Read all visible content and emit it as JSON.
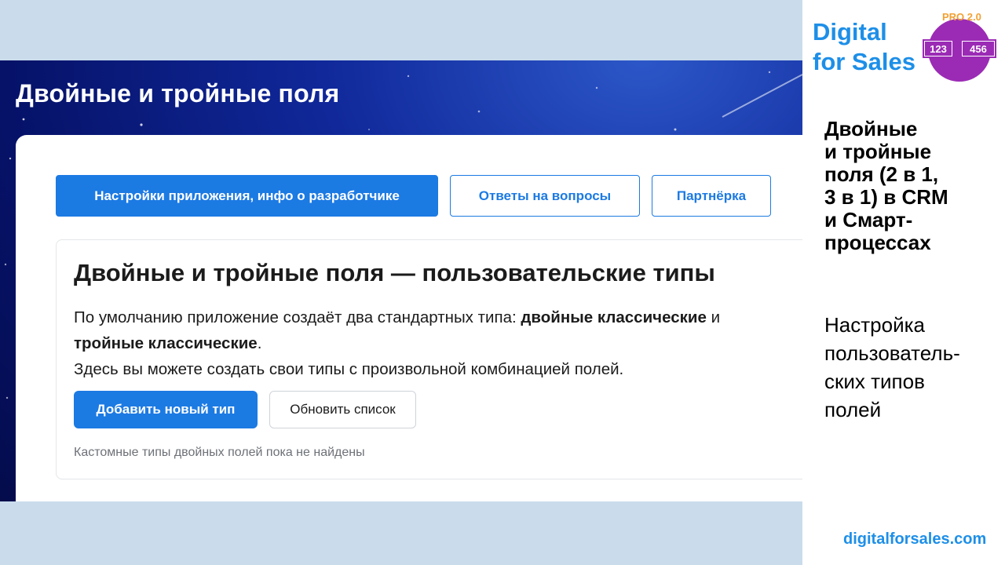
{
  "app": {
    "header_title": "Двойные и тройные поля",
    "tabs": [
      {
        "label": "Настройки приложения, инфо о разработчике",
        "active": true
      },
      {
        "label": "Ответы на вопросы",
        "active": false
      },
      {
        "label": "Партнёрка",
        "active": false
      }
    ],
    "section": {
      "title": "Двойные и тройные поля — пользовательские типы",
      "desc_part1": "По умолчанию приложение создаёт два стандартных типа: ",
      "desc_bold1": "двойные классические",
      "desc_part2": " и ",
      "desc_bold2": "тройные классические",
      "desc_part3": ".",
      "desc_line2": "Здесь вы можете создать свои типы с произвольной комбинацией полей.",
      "add_button": "Добавить новый тип",
      "refresh_button": "Обновить список",
      "empty_note": "Кастомные типы двойных полей пока не найдены"
    }
  },
  "side": {
    "brand_line1": "Digital",
    "brand_line2": "for Sales",
    "logo_badge": "PRO 2.0",
    "logo_num1": "123",
    "logo_num2": "456",
    "title": "Двойные\nи тройные\nполя (2 в 1,\n3 в 1) в CRM\nи Смарт-\nпроцессах",
    "subtitle": "Настройка\nпользователь-\nских типов\nполей",
    "website": "digitalforsales.com"
  },
  "colors": {
    "accent_blue": "#1c7ae3",
    "brand_blue": "#1d8fe8",
    "logo_purple": "#9b2bb5",
    "logo_orange": "#f2a033",
    "slide_bg": "#cadcec"
  },
  "icons": [
    "brand-logo-icon",
    "star-decoration"
  ]
}
